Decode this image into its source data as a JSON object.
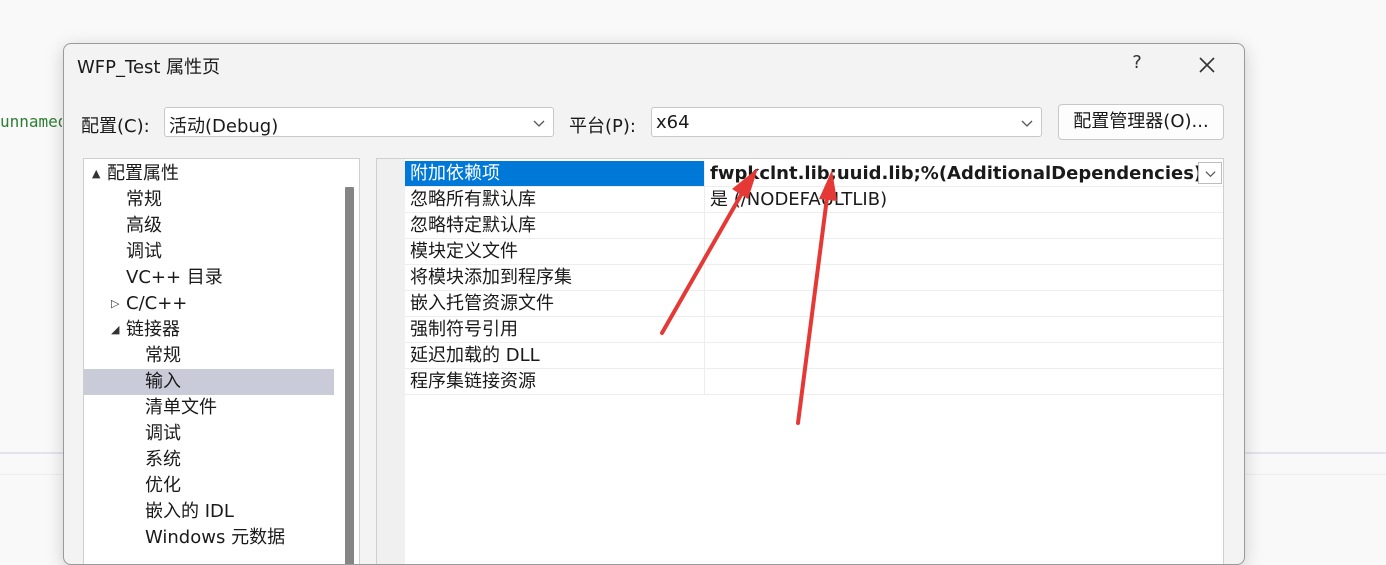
{
  "background": {
    "code_fragment": "unnamed"
  },
  "dialog": {
    "title": "WFP_Test 属性页",
    "help_label": "?",
    "config_label": "配置(C):",
    "config_value": "活动(Debug)",
    "platform_label": "平台(P):",
    "platform_value": "x64",
    "manager_button": "配置管理器(O)..."
  },
  "tree": {
    "items": [
      {
        "label": "配置属性",
        "expander": "▲"
      },
      {
        "label": "常规"
      },
      {
        "label": "高级"
      },
      {
        "label": "调试"
      },
      {
        "label": "VC++ 目录"
      },
      {
        "label": "C/C++",
        "expander": "▷"
      },
      {
        "label": "链接器",
        "expander": "◢"
      },
      {
        "label": "常规"
      },
      {
        "label": "输入",
        "selected": true
      },
      {
        "label": "清单文件"
      },
      {
        "label": "调试"
      },
      {
        "label": "系统"
      },
      {
        "label": "优化"
      },
      {
        "label": "嵌入的 IDL"
      },
      {
        "label": "Windows 元数据"
      }
    ]
  },
  "properties": {
    "rows": [
      {
        "name": "附加依赖项",
        "value": "fwpkclnt.lib;uuid.lib;%(AdditionalDependencies)"
      },
      {
        "name": "忽略所有默认库",
        "value": "是 (/NODEFAULTLIB)"
      },
      {
        "name": "忽略特定默认库",
        "value": ""
      },
      {
        "name": "模块定义文件",
        "value": ""
      },
      {
        "name": "将模块添加到程序集",
        "value": ""
      },
      {
        "name": "嵌入托管资源文件",
        "value": ""
      },
      {
        "name": "强制符号引用",
        "value": ""
      },
      {
        "name": "延迟加载的 DLL",
        "value": ""
      },
      {
        "name": "程序集链接资源",
        "value": ""
      }
    ]
  },
  "colors": {
    "selection_blue": "#0078d7",
    "tree_selection": "#c9cbd9",
    "annotation_red": "#e53935"
  },
  "icons": {
    "close": "close-icon",
    "dropdown": "chevron-down-icon",
    "annotation": "red-arrow-icon"
  }
}
